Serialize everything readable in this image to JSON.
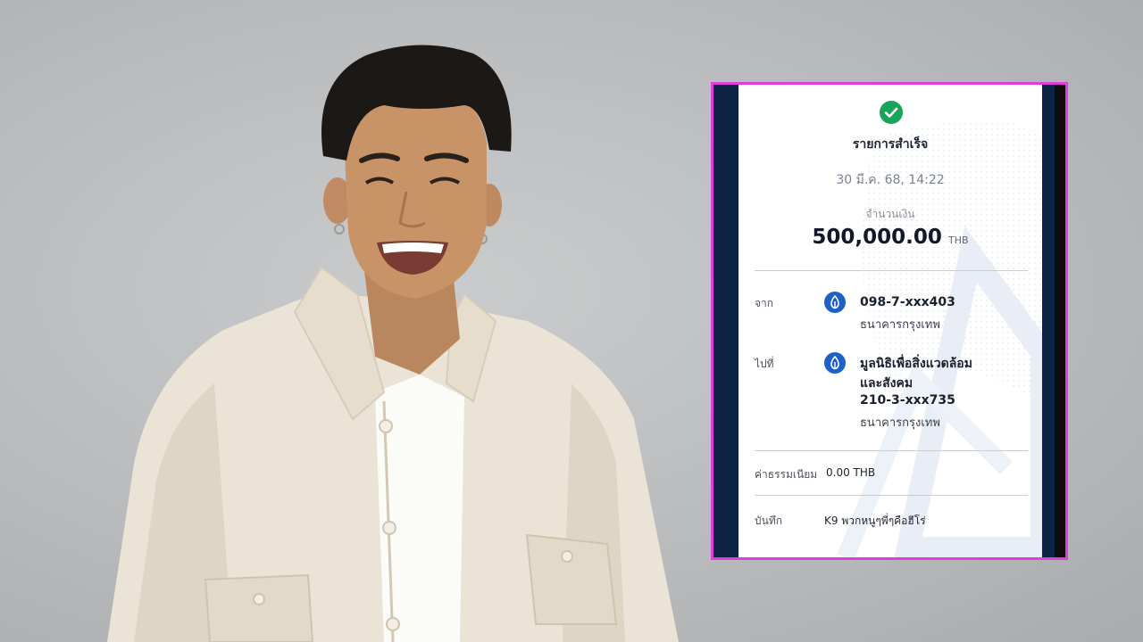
{
  "receipt": {
    "status_title": "รายการสำเร็จ",
    "datetime": "30 มี.ค. 68, 14:22",
    "amount_label": "จำนวนเงิน",
    "amount_value": "500,000.00",
    "amount_currency": "THB",
    "from": {
      "label": "จาก",
      "account": "098-7-xxx403",
      "bank": "ธนาคารกรุงเทพ"
    },
    "to": {
      "label": "ไปที่",
      "name_line1": "มูลนิธิเพื่อสิ่งแวดล้อม",
      "name_line2": "และสังคม",
      "account": "210-3-xxx735",
      "bank": "ธนาคารกรุงเทพ"
    },
    "fee": {
      "label": "ค่าธรรมเนียม",
      "value": "0.00 THB"
    },
    "note": {
      "label": "บันทึก",
      "value": "K9 พวกหนูๆพี่ๆคือฮีโร่"
    }
  },
  "colors": {
    "frame_border": "#e23be0",
    "navy": "#0d2346",
    "success_green": "#1aa35a",
    "bank_blue": "#1f5fc8"
  }
}
